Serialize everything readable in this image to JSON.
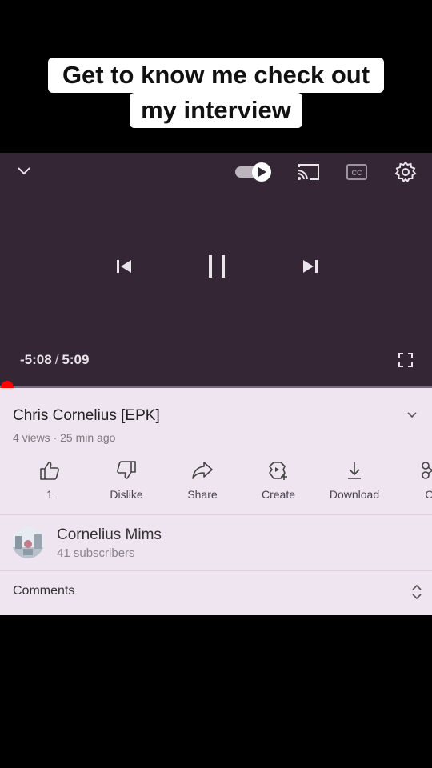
{
  "caption": {
    "line1": "Get to know me check out",
    "line2": "my interview"
  },
  "player": {
    "time_remaining": "-5:08",
    "time_separator": "/",
    "time_total": "5:09",
    "autoplay_on": true,
    "progress_fraction": 0.003
  },
  "video": {
    "title": "Chris Cornelius [EPK]",
    "meta": "4 views · 25 min ago"
  },
  "actions": [
    {
      "name": "like",
      "icon": "thumbs-up-icon",
      "label": "1"
    },
    {
      "name": "dislike",
      "icon": "thumbs-down-icon",
      "label": "Dislike"
    },
    {
      "name": "share",
      "icon": "share-icon",
      "label": "Share"
    },
    {
      "name": "create",
      "icon": "create-icon",
      "label": "Create"
    },
    {
      "name": "download",
      "icon": "download-icon",
      "label": "Download"
    },
    {
      "name": "clip",
      "icon": "scissors-icon",
      "label": "Cl"
    }
  ],
  "channel": {
    "name": "Cornelius Mims",
    "subscribers": "41 subscribers"
  },
  "comments": {
    "label": "Comments"
  },
  "colors": {
    "player_bg": "#352636",
    "info_bg": "#efe5f0",
    "accent": "#ff0000"
  }
}
